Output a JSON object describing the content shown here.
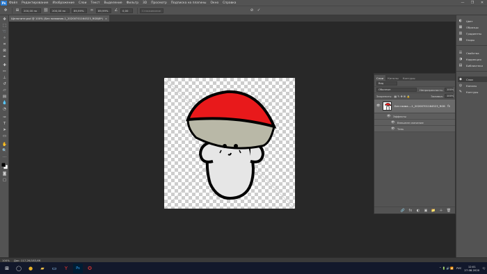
{
  "menubar": {
    "logo": "Ps",
    "items": [
      "Файл",
      "Редактирование",
      "Изображение",
      "Слои",
      "Текст",
      "Выделение",
      "Фильтр",
      "3D",
      "Просмотр",
      "Подписка на плагины",
      "Окно",
      "Справка"
    ],
    "win_controls": [
      "—",
      "❐",
      "✕"
    ]
  },
  "options": {
    "field_w": "200,00 пк",
    "field_h": "200,00 пк",
    "field_zoom1": "89,99%",
    "field_zoom2": "89,99%",
    "field_angle": "0,00",
    "interp": "Сглаживание",
    "cancel": "⊘",
    "commit": "✓"
  },
  "document": {
    "tab_title": "Щелкните.psd @ 100% (Без названия-1_20200701164523_RGB/8*)",
    "tab_close": "×"
  },
  "status": {
    "zoom": "100%",
    "doc_size": "Док: 117,2К/183,6К"
  },
  "dock": [
    {
      "label": "Цвет",
      "icon": "◐"
    },
    {
      "label": "Образцы",
      "icon": "▦"
    },
    {
      "label": "Градиенты",
      "icon": "▥"
    },
    {
      "label": "Узоры",
      "icon": "▩"
    },
    {
      "label": "Свойства",
      "icon": "☰"
    },
    {
      "label": "Коррекция",
      "icon": "◑"
    },
    {
      "label": "Библиотеки",
      "icon": "▤"
    },
    {
      "label": "Слои",
      "icon": "◆"
    },
    {
      "label": "Каналы",
      "icon": "◎"
    },
    {
      "label": "Контуры",
      "icon": "✎"
    }
  ],
  "layers": {
    "tabs": [
      "Слои",
      "Каналы",
      "Контуры"
    ],
    "kind": "Вид",
    "blend": "Обычные",
    "opacity_label": "Непрозрачность:",
    "opacity": "100%",
    "lock_label": "Закрепить:",
    "fill_label": "Заливка:",
    "fill": "100%",
    "layer_name": "Без назва...-1_20200701164523_RGB",
    "fx_badge": "fx",
    "effects": "Эффекты",
    "effect_items": [
      "Внешнее свечение",
      "Тень"
    ],
    "footer_icons": [
      "🔗",
      "fx",
      "◐",
      "▣",
      "📁",
      "＋",
      "🗑"
    ]
  },
  "taskbar": {
    "icons": [
      {
        "name": "start",
        "glyph": "⊞",
        "color": "#ffffff"
      },
      {
        "name": "search",
        "glyph": "◯",
        "color": "#dddddd"
      },
      {
        "name": "chrome",
        "glyph": "●",
        "color": "#e8b32a"
      },
      {
        "name": "explorer",
        "glyph": "▰",
        "color": "#f1c04a"
      },
      {
        "name": "files",
        "glyph": "▭",
        "color": "#9ad0ff"
      },
      {
        "name": "yandex",
        "glyph": "Y",
        "color": "#e33"
      },
      {
        "name": "photoshop",
        "glyph": "Ps",
        "color": "#31a8ff"
      },
      {
        "name": "app",
        "glyph": "✪",
        "color": "#c33"
      }
    ],
    "lang": "РУС",
    "time": "12:01",
    "date": "27.08.2020"
  }
}
